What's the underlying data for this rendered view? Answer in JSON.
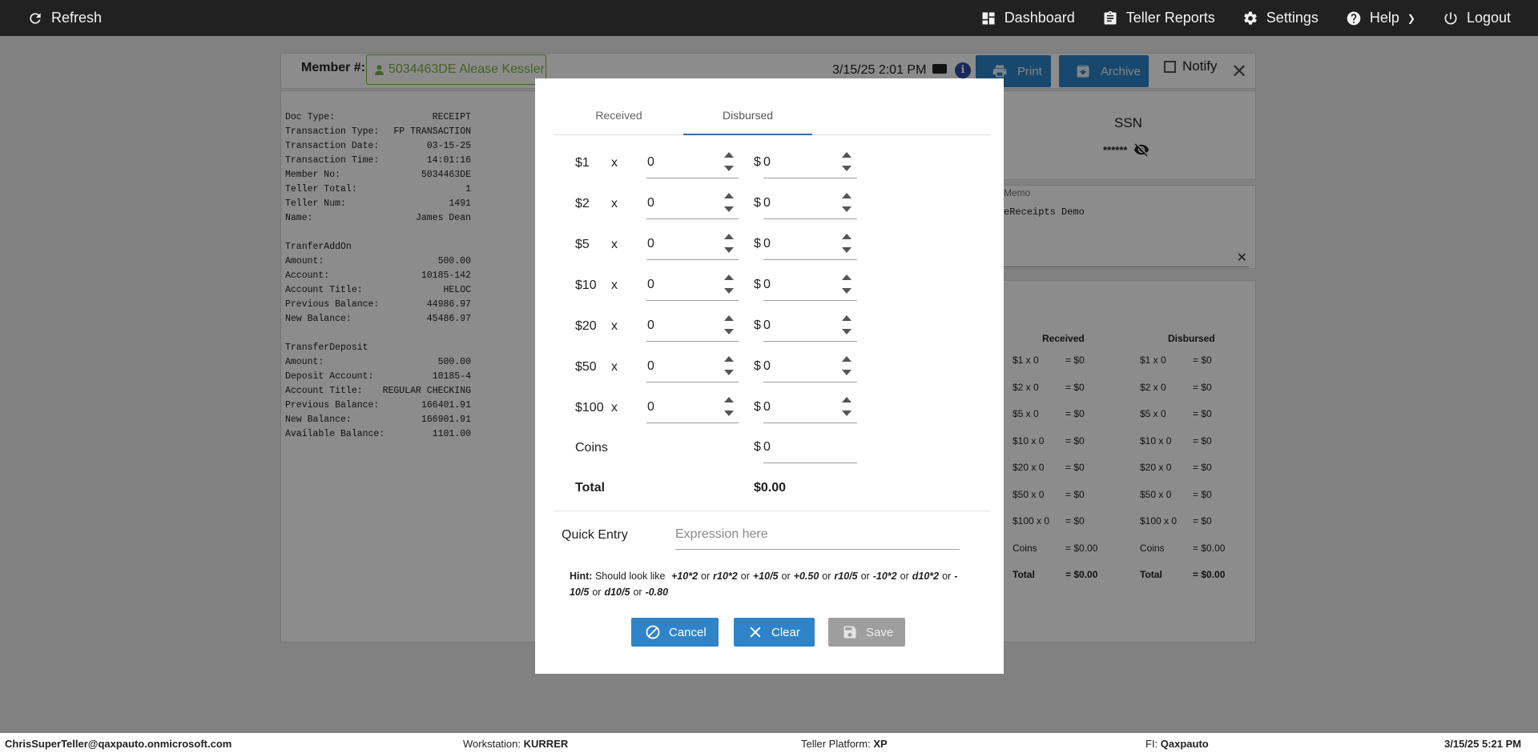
{
  "topbar": {
    "refresh": "Refresh",
    "dashboard": "Dashboard",
    "teller_reports": "Teller Reports",
    "settings": "Settings",
    "help": "Help",
    "logout": "Logout"
  },
  "header": {
    "member_label": "Member #:",
    "member_value": "5034463DE Alease Kessler",
    "datetime": "3/15/25 2:01 PM",
    "print": "Print",
    "archive": "Archive",
    "notify": "Notify"
  },
  "receipt": {
    "rows": [
      [
        "Doc Type:",
        "RECEIPT"
      ],
      [
        "Transaction Type:",
        "FP TRANSACTION"
      ],
      [
        "Transaction Date:",
        "03-15-25"
      ],
      [
        "Transaction Time:",
        "14:01:16"
      ],
      [
        "Member No:",
        "5034463DE"
      ],
      [
        "Teller Total:",
        "1"
      ],
      [
        "Teller Num:",
        "1491"
      ],
      [
        "Name:",
        "James Dean"
      ]
    ],
    "section1_title": "TranferAddOn",
    "section1": [
      [
        "Amount:",
        "500.00"
      ],
      [
        "Account:",
        "10185-142"
      ],
      [
        "Account Title:",
        "HELOC"
      ],
      [
        "Previous Balance:",
        "44986.97"
      ],
      [
        "New Balance:",
        "45486.97"
      ]
    ],
    "section2_title": "TransferDeposit",
    "section2": [
      [
        "Amount:",
        "500.00"
      ],
      [
        "Deposit Account:",
        "10185-4"
      ],
      [
        "Account Title:",
        "REGULAR CHECKING"
      ],
      [
        "Previous Balance:",
        "166401.91"
      ],
      [
        "New Balance:",
        "166901.91"
      ],
      [
        "Available Balance:",
        "1101.00"
      ]
    ]
  },
  "ssn": {
    "title": "SSN",
    "masked": "******"
  },
  "memo": {
    "label": "Memo",
    "text": "eReceipts Demo"
  },
  "cash_summary": {
    "received_header": "Received",
    "disbursed_header": "Disbursed",
    "received": [
      [
        "$1 x 0",
        "= $0"
      ],
      [
        "$2 x 0",
        "= $0"
      ],
      [
        "$5 x 0",
        "= $0"
      ],
      [
        "$10 x 0",
        "= $0"
      ],
      [
        "$20 x 0",
        "= $0"
      ],
      [
        "$50 x 0",
        "= $0"
      ],
      [
        "$100 x 0",
        "= $0"
      ],
      [
        "Coins",
        "= $0.00"
      ],
      [
        "Total",
        "= $0.00"
      ]
    ],
    "disbursed": [
      [
        "$1 x 0",
        "= $0"
      ],
      [
        "$2 x 0",
        "= $0"
      ],
      [
        "$5 x 0",
        "= $0"
      ],
      [
        "$10 x 0",
        "= $0"
      ],
      [
        "$20 x 0",
        "= $0"
      ],
      [
        "$50 x 0",
        "= $0"
      ],
      [
        "$100 x 0",
        "= $0"
      ],
      [
        "Coins",
        "= $0.00"
      ],
      [
        "Total",
        "= $0.00"
      ]
    ]
  },
  "modal": {
    "tabs": [
      "Received",
      "Disbursed"
    ],
    "active_tab": "Disbursed",
    "x_symbol": "x",
    "currency_symbol": "$",
    "denominations": [
      {
        "label": "$1",
        "count": "0",
        "amount": "0"
      },
      {
        "label": "$2",
        "count": "0",
        "amount": "0"
      },
      {
        "label": "$5",
        "count": "0",
        "amount": "0"
      },
      {
        "label": "$10",
        "count": "0",
        "amount": "0"
      },
      {
        "label": "$20",
        "count": "0",
        "amount": "0"
      },
      {
        "label": "$50",
        "count": "0",
        "amount": "0"
      },
      {
        "label": "$100",
        "count": "0",
        "amount": "0"
      }
    ],
    "coins_label": "Coins",
    "coins_amount": "0",
    "total_label": "Total",
    "total_value": "$0.00",
    "quick_entry_label": "Quick Entry",
    "quick_entry_placeholder": "Expression here",
    "hint_label": "Hint:",
    "hint_text": "Should look like",
    "hint_examples": [
      "+10*2",
      "r10*2",
      "+10/5",
      "+0.50",
      "r10/5",
      "-10*2",
      "d10*2",
      "-10/5",
      "d10/5",
      "-0.80"
    ],
    "hint_separator": "or",
    "cancel": "Cancel",
    "clear": "Clear",
    "save": "Save"
  },
  "status": {
    "user": "ChrisSuperTeller@qaxpauto.onmicrosoft.com",
    "workstation_label": "Workstation:",
    "workstation": "KURRER",
    "platform_label": "Teller Platform:",
    "platform": "XP",
    "fi_label": "FI:",
    "fi": "Qaxpauto",
    "datetime": "3/15/25 5:21 PM"
  },
  "colors": {
    "primary_button": "#2f84c9",
    "member_green": "#7cb342",
    "topbar": "#212121"
  }
}
